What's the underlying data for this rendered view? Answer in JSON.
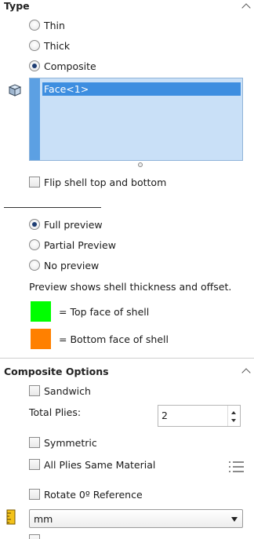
{
  "type_section": {
    "title": "Type",
    "options": [
      {
        "label": "Thin",
        "selected": false
      },
      {
        "label": "Thick",
        "selected": false
      },
      {
        "label": "Composite",
        "selected": true
      }
    ]
  },
  "selection_box": {
    "icon": "face-selection-icon",
    "items": [
      "Face<1>"
    ]
  },
  "flip_shell": {
    "label": "Flip shell top and bottom",
    "checked": false
  },
  "preview_section": {
    "options": [
      {
        "label": "Full preview",
        "selected": true
      },
      {
        "label": "Partial Preview",
        "selected": false
      },
      {
        "label": "No preview",
        "selected": false
      }
    ],
    "description": "Preview shows shell thickness and offset.",
    "legend": [
      {
        "color": "#00ff00",
        "label": "= Top face of shell"
      },
      {
        "color": "#ff8000",
        "label": "= Bottom face of shell"
      }
    ]
  },
  "composite_options": {
    "title": "Composite Options",
    "sandwich": {
      "label": "Sandwich",
      "checked": false
    },
    "total_plies": {
      "label": "Total Plies:",
      "value": "2"
    },
    "symmetric": {
      "label": "Symmetric",
      "checked": false
    },
    "all_plies_same_material": {
      "label": "All Plies Same Material",
      "checked": false
    },
    "rotate_reference": {
      "label": "Rotate 0º Reference",
      "checked": false
    },
    "units": {
      "icon": "ruler-icon",
      "value": "mm"
    }
  }
}
